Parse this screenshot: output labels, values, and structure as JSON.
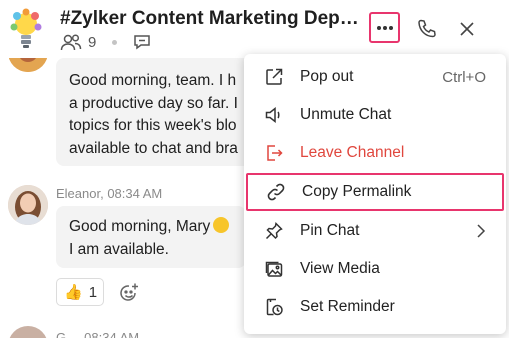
{
  "header": {
    "channel_title": "#Zylker Content Marketing Department",
    "member_count": "9",
    "logo_icon": "lightbulb-logo-icon",
    "members_icon": "members-icon",
    "thread_icon": "chat-bubble-icon",
    "more_icon": "more-horizontal-icon",
    "call_icon": "phone-icon",
    "close_icon": "close-icon",
    "highlight_color": "#e8356d"
  },
  "messages": [
    {
      "lines": [
        "Good morning, team. I h",
        "a productive day so far. I",
        "topics for this week's blo",
        "available to chat and bra"
      ]
    },
    {
      "sender": "Eleanor",
      "time": "08:34 AM",
      "sender_line": "Eleanor, 08:34 AM",
      "lines": [
        "Good morning, Mary",
        "I am available."
      ],
      "reaction": {
        "emoji": "👍",
        "count": "1"
      }
    },
    {
      "sender_line": "G ... 08:34 AM"
    }
  ],
  "menu": {
    "items": [
      {
        "label": "Pop out",
        "shortcut": "Ctrl+O",
        "icon": "pop-out-icon"
      },
      {
        "label": "Unmute Chat",
        "icon": "speaker-icon"
      },
      {
        "label": "Leave Channel",
        "icon": "leave-icon",
        "color": "#e0473e"
      },
      {
        "label": "Copy Permalink",
        "icon": "link-icon",
        "highlighted": true
      },
      {
        "label": "Pin Chat",
        "icon": "pin-icon",
        "has_submenu": true
      },
      {
        "label": "View Media",
        "icon": "media-icon"
      },
      {
        "label": "Set Reminder",
        "icon": "reminder-icon"
      }
    ]
  }
}
